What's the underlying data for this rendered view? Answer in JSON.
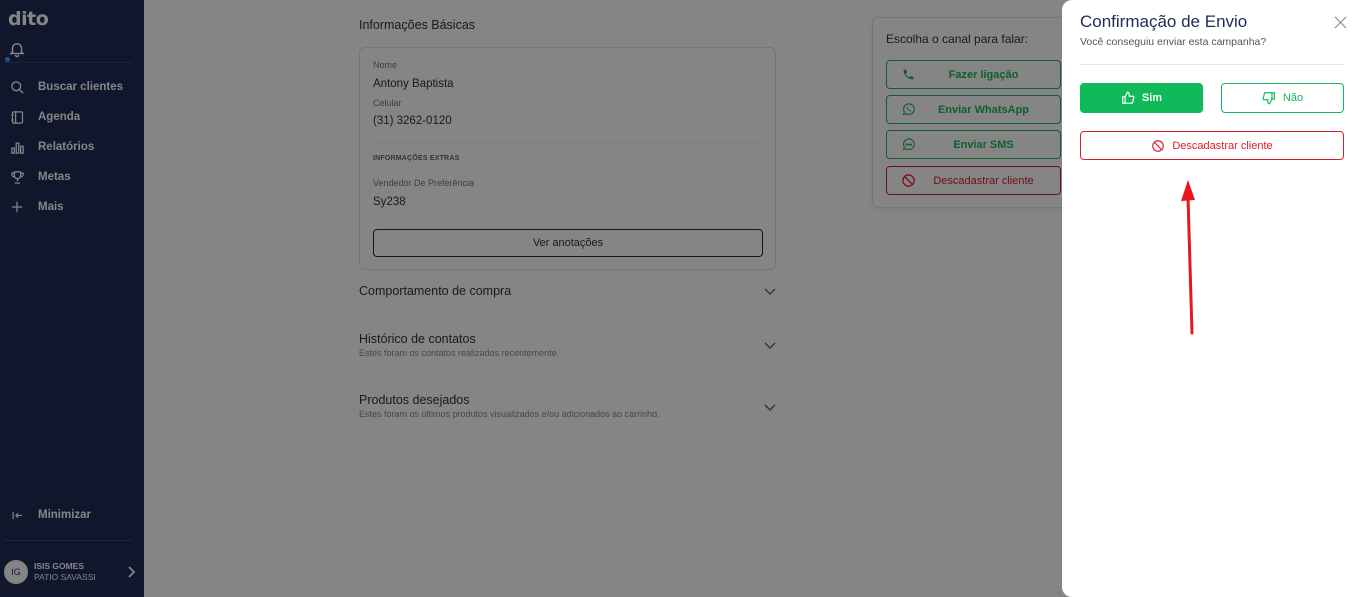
{
  "sidebar": {
    "logo": "dito",
    "nav": [
      {
        "label": "Buscar clientes",
        "icon": "search-icon"
      },
      {
        "label": "Agenda",
        "icon": "agenda-icon"
      },
      {
        "label": "Relatórios",
        "icon": "bar-chart-icon"
      },
      {
        "label": "Metas",
        "icon": "trophy-icon"
      },
      {
        "label": "Mais",
        "icon": "plus-icon"
      }
    ],
    "minimize_label": "Minimizar",
    "user": {
      "initials": "IG",
      "name": "ISIS GOMES",
      "store": "PATIO SAVASSI"
    }
  },
  "basic_info": {
    "title": "Informações Básicas",
    "name_label": "Nome",
    "name_value": "Antony Baptista",
    "phone_label": "Celular",
    "phone_value": "(31) 3262-0120",
    "extra_title": "INFORMAÇÕES EXTRAS",
    "seller_label": "Vendedor De Preferência",
    "seller_value": "Sy238",
    "notes_button": "Ver anotações"
  },
  "accordions": [
    {
      "title": "Comportamento de compra",
      "subtitle": ""
    },
    {
      "title": "Histórico de contatos",
      "subtitle": "Estes foram os contatos realizados recentemente."
    },
    {
      "title": "Produtos desejados",
      "subtitle": "Estes foram os últimos produtos visualizados e/ou adicionados ao carrinho."
    }
  ],
  "channels": {
    "title": "Escolha o canal para falar:",
    "call": "Fazer ligação",
    "whatsapp": "Enviar WhatsApp",
    "sms": "Enviar SMS",
    "unsubscribe": "Descadastrar cliente"
  },
  "modal": {
    "title": "Confirmação de Envio",
    "subtitle": "Você conseguiu enviar esta campanha?",
    "yes": "Sim",
    "no": "Não",
    "unsubscribe": "Descadastrar cliente"
  },
  "colors": {
    "sidebar_bg": "#1f2c55",
    "green": "#10b95a",
    "red": "#d81e2c",
    "annotation_arrow": "#e8161e"
  }
}
